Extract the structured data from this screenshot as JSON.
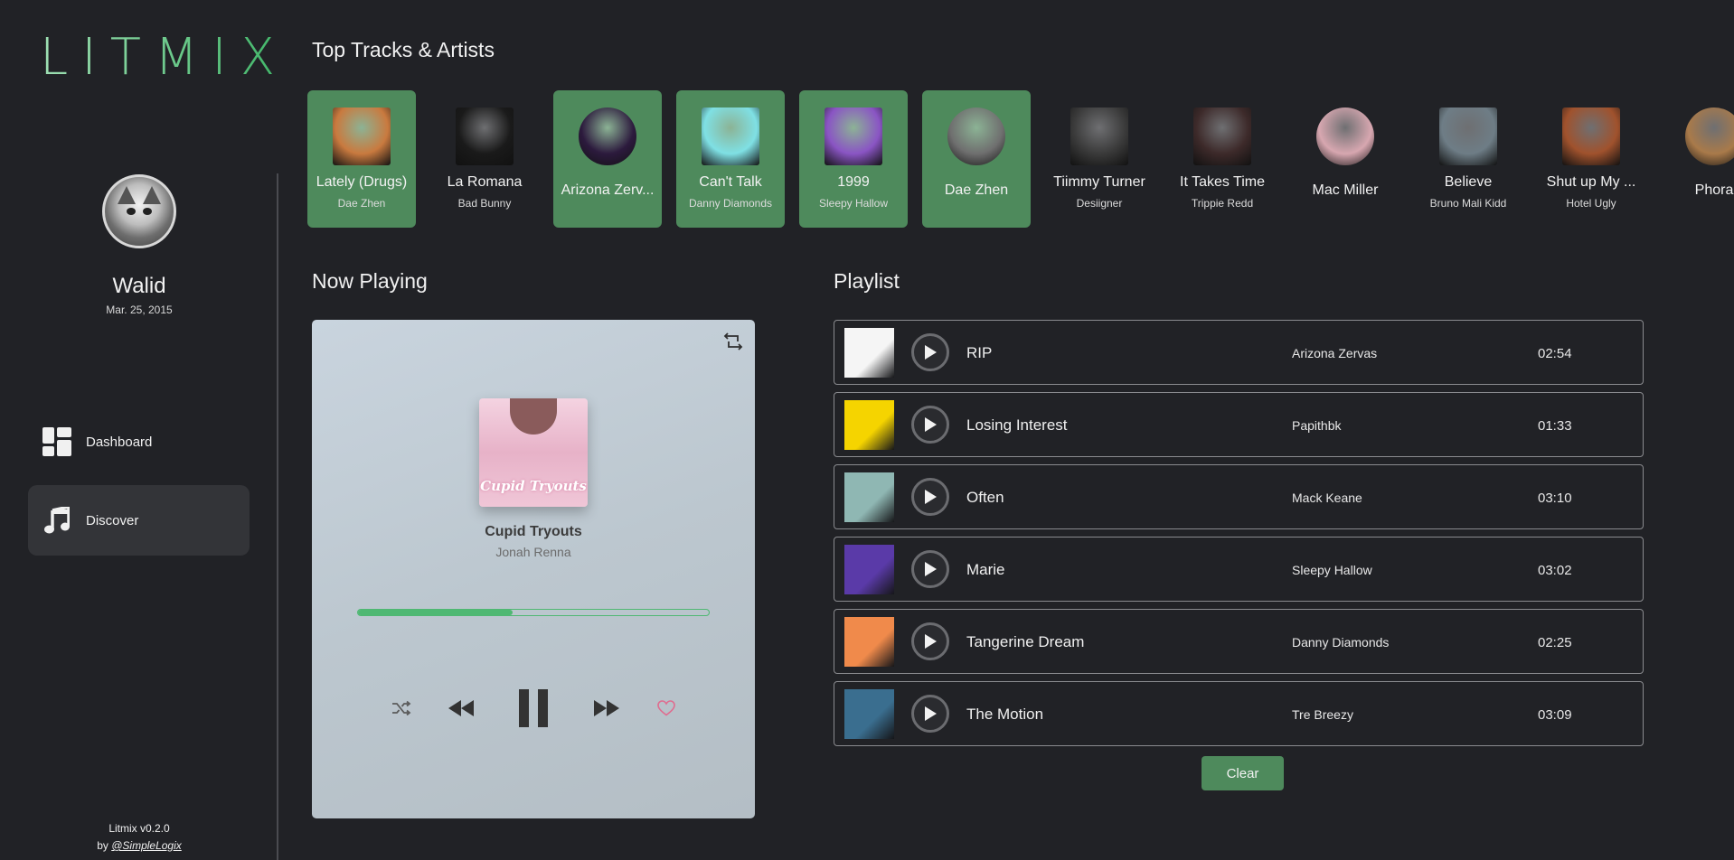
{
  "app": {
    "logo": "LITMIX",
    "version": "Litmix v0.2.0",
    "by_prefix": "by ",
    "by_link": "@SimpleLogix"
  },
  "user": {
    "name": "Walid",
    "date": "Mar. 25, 2015"
  },
  "nav": [
    {
      "label": "Dashboard",
      "icon": "dashboard-icon",
      "active": false
    },
    {
      "label": "Discover",
      "icon": "music-note-icon",
      "active": true
    }
  ],
  "top": {
    "title": "Top Tracks & Artists",
    "items": [
      {
        "title": "Lately (Drugs)",
        "sub": "Dae Zhen",
        "selected": true,
        "kind": "track",
        "color": "#c97a3f"
      },
      {
        "title": "La Romana",
        "sub": "Bad Bunny",
        "selected": false,
        "kind": "track",
        "color": "#1a1a1a"
      },
      {
        "title": "Arizona Zerv...",
        "sub": "",
        "selected": true,
        "kind": "artist",
        "color": "#2c1a3d"
      },
      {
        "title": "Can't Talk",
        "sub": "Danny Diamonds",
        "selected": true,
        "kind": "track",
        "color": "#7fe0e4"
      },
      {
        "title": "1999",
        "sub": "Sleepy Hallow",
        "selected": true,
        "kind": "track",
        "color": "#8a55c4"
      },
      {
        "title": "Dae Zhen",
        "sub": "",
        "selected": true,
        "kind": "artist",
        "color": "#6f6f6f"
      },
      {
        "title": "Tiimmy Turner",
        "sub": "Desiigner",
        "selected": false,
        "kind": "track",
        "color": "#3a3a3a"
      },
      {
        "title": "It Takes Time",
        "sub": "Trippie Redd",
        "selected": false,
        "kind": "track",
        "color": "#3d2a2a"
      },
      {
        "title": "Mac Miller",
        "sub": "",
        "selected": false,
        "kind": "artist",
        "color": "#d7a7b0"
      },
      {
        "title": "Believe",
        "sub": "Bruno Mali Kidd",
        "selected": false,
        "kind": "track",
        "color": "#6e7d86"
      },
      {
        "title": "Shut up My ...",
        "sub": "Hotel Ugly",
        "selected": false,
        "kind": "track",
        "color": "#a0522d"
      },
      {
        "title": "Phora",
        "sub": "",
        "selected": false,
        "kind": "artist",
        "color": "#a97a4a"
      }
    ]
  },
  "now_playing": {
    "title": "Now Playing",
    "cover_text": "Cupid Tryouts",
    "song": "Cupid Tryouts",
    "artist": "Jonah Renna",
    "progress": 0.44
  },
  "playlist": {
    "title": "Playlist",
    "rows": [
      {
        "title": "RIP",
        "artist": "Arizona Zervas",
        "duration": "02:54",
        "thumb": "#f5f5f5"
      },
      {
        "title": "Losing Interest",
        "artist": "Papithbk",
        "duration": "01:33",
        "thumb": "#f5d400"
      },
      {
        "title": "Often",
        "artist": "Mack Keane",
        "duration": "03:10",
        "thumb": "#8fb7b3"
      },
      {
        "title": "Marie",
        "artist": "Sleepy Hallow",
        "duration": "03:02",
        "thumb": "#5a3aa8"
      },
      {
        "title": "Tangerine Dream",
        "artist": "Danny Diamonds",
        "duration": "02:25",
        "thumb": "#f08a4b"
      },
      {
        "title": "The Motion",
        "artist": "Tre Breezy",
        "duration": "03:09",
        "thumb": "#3a6e8f"
      }
    ],
    "clear_label": "Clear"
  }
}
